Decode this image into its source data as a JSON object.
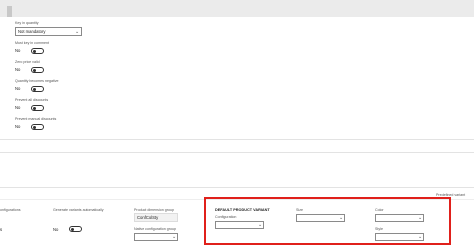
{
  "header": {},
  "item_fields": {
    "qty_label": "Key in quantity",
    "qty_value": "Not mandatory",
    "must_key_in_comment": {
      "label": "Must key in comment",
      "value": "No"
    },
    "zero_price_valid": {
      "label": "Zero price valid",
      "value": "No"
    },
    "quantity_becomes_negative": {
      "label": "Quantity becomes negative",
      "value": "No"
    },
    "prevent_all_discounts": {
      "label": "Prevent all discounts",
      "value": "No"
    },
    "prevent_manual_discounts": {
      "label": "Prevent manual discounts",
      "value": "No"
    }
  },
  "bottom": {
    "predefined_variant_link": "Predefined variant",
    "configurations_label": "onfigurations",
    "configurations_value": "s",
    "generate_variants": {
      "label": "Generate variants automatically",
      "value": "No"
    },
    "product_dimension_group": {
      "label": "Product dimension group",
      "value": "ConfColSty"
    },
    "native_configuration_group": {
      "label": "Native configuration group",
      "value": ""
    },
    "product_variant_section": {
      "title": "DEFAULT PRODUCT VARIANT",
      "configuration_label": "Configuration",
      "configuration_value": "",
      "size_label": "Size",
      "size_value": "",
      "color_label": "Color",
      "color_value": "",
      "style_label": "Style",
      "style_value": ""
    }
  },
  "colors": {
    "highlight": "#e0201b",
    "topbar": "#ebebeb"
  }
}
